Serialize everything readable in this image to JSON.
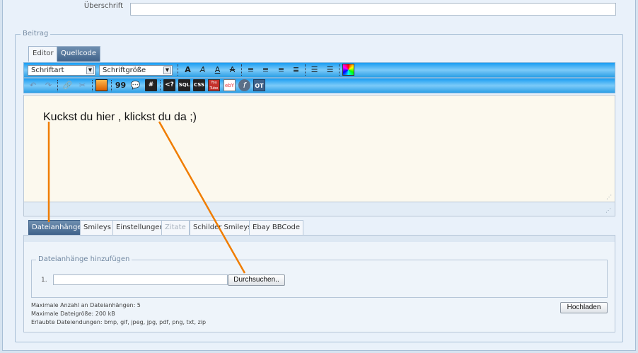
{
  "heading": {
    "label": "Überschrift",
    "value": ""
  },
  "post_legend": "Beitrag",
  "editor_tabs": [
    {
      "label": "Editor",
      "active": false
    },
    {
      "label": "Quellcode",
      "active": true
    }
  ],
  "toolbar": {
    "font_select": "Schriftart",
    "size_select": "Schriftgröße",
    "quote_glyph": "99",
    "hash_glyph": "#",
    "php_label": "<?",
    "sql_label": "SQL",
    "css_label": "CSS",
    "yt_label": "You Tube",
    "ebay_label": "ebY",
    "ot_label": "OT"
  },
  "editor_content": "Kuckst du hier , klickst du da ;)",
  "lower_tabs": [
    {
      "label": "Dateianhänge",
      "active": true
    },
    {
      "label": "Smileys"
    },
    {
      "label": "Einstellungen"
    },
    {
      "label": "Zitate",
      "disabled": true
    },
    {
      "label": "Schilder Smileys"
    },
    {
      "label": "Ebay BBCode"
    }
  ],
  "attachments": {
    "legend": "Dateianhänge hinzufügen",
    "row_number": "1.",
    "browse_label": "Durchsuchen..",
    "upload_label": "Hochladen",
    "info": [
      "Maximale Anzahl an Dateianhängen: 5",
      "Maximale Dateigröße: 200 kB",
      "Erlaubte Dateiendungen: bmp, gif, jpeg, jpg, pdf, png, txt, zip"
    ]
  },
  "colors": {
    "toolbar_blue": "#1a9df2",
    "active_tab": "#3e6189",
    "annotation_orange": "#f07d00",
    "editor_bg": "#fcf9ee"
  }
}
